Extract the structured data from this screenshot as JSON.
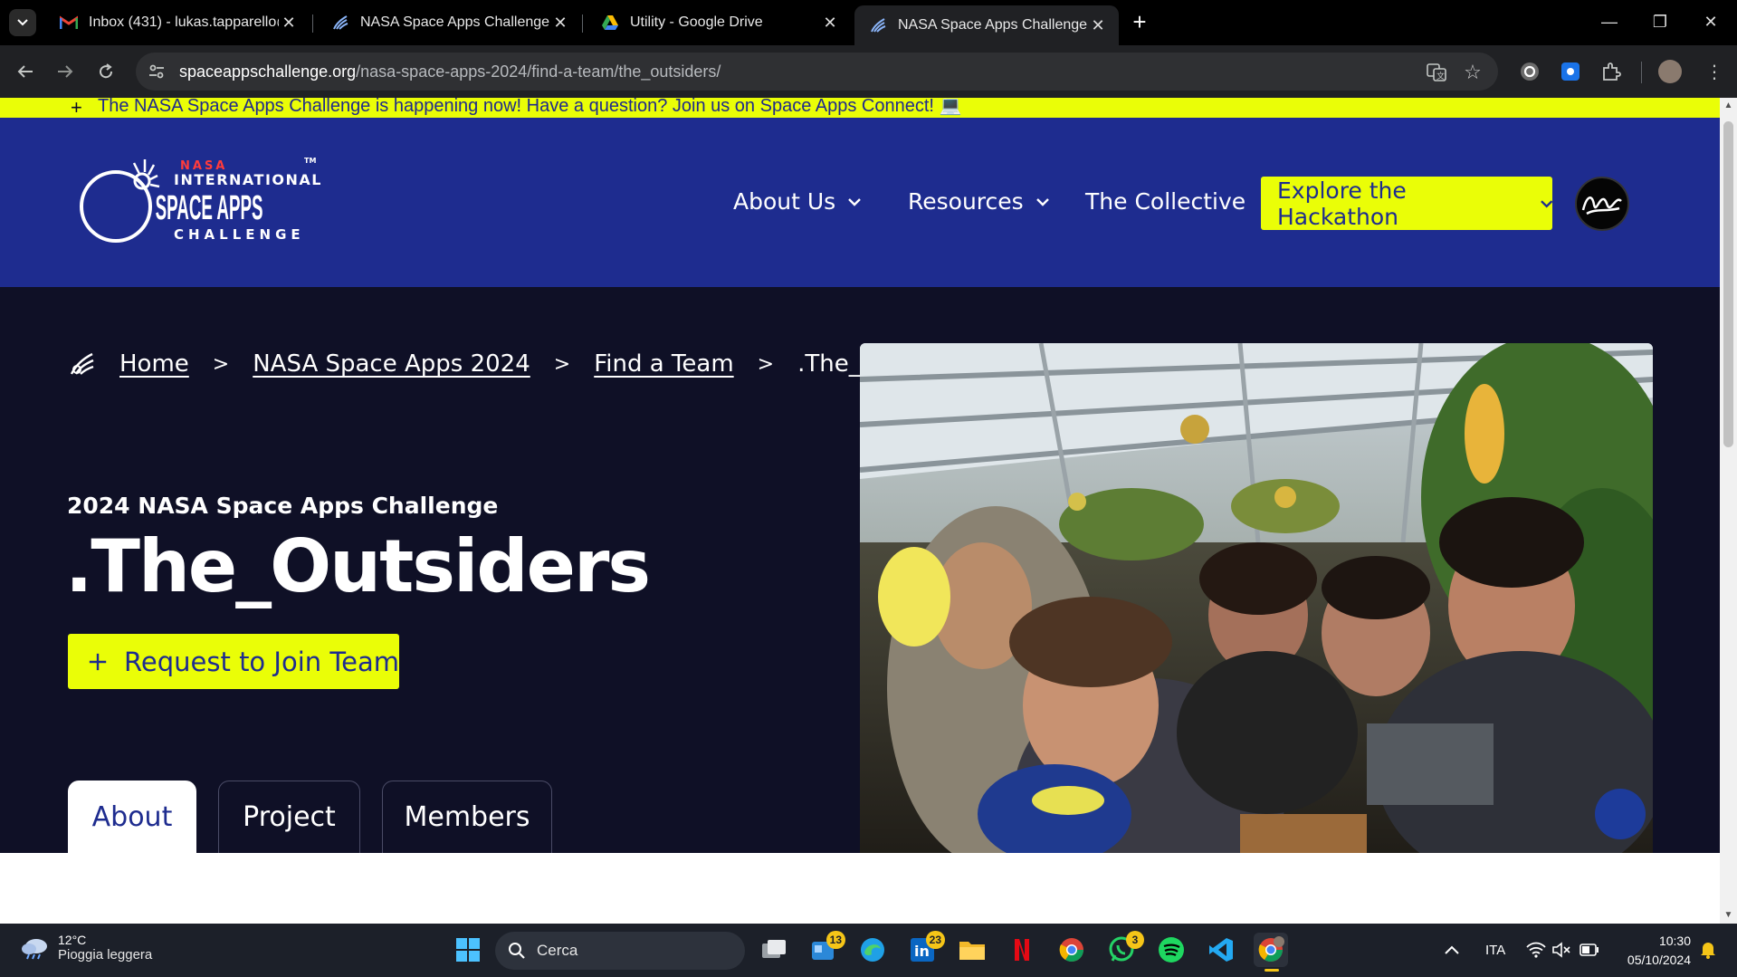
{
  "browser": {
    "tabs": [
      {
        "title": "Inbox (431) - lukas.tapparello@",
        "icon": "gmail-icon",
        "active": false
      },
      {
        "title": "NASA Space Apps Challenge",
        "icon": "space-apps-icon",
        "active": false
      },
      {
        "title": "Utility - Google Drive",
        "icon": "google-drive-icon",
        "active": false
      },
      {
        "title": "NASA Space Apps Challenge",
        "icon": "space-apps-icon",
        "active": true
      }
    ],
    "url_host": "spaceappschallenge.org",
    "url_path": "/nasa-space-apps-2024/find-a-team/the_outsiders/"
  },
  "page": {
    "banner_text": "The NASA Space Apps Challenge is happening now! Have a question? Join us on Space Apps Connect! 💻",
    "logo": {
      "line1": "NASA",
      "line2": "INTERNATIONAL",
      "line3": "SPACE APPS",
      "line4": "CHALLENGE",
      "tm": "TM"
    },
    "nav": {
      "about": "About Us",
      "resources": "Resources",
      "collective": "The Collective",
      "cta": "Explore the Hackathon"
    },
    "breadcrumb": {
      "home": "Home",
      "event": "NASA Space Apps 2024",
      "find_team": "Find a Team",
      "current": ".The_Outsiders"
    },
    "hero": {
      "subtitle": "2024 NASA Space Apps Challenge",
      "title": ".The_Outsiders",
      "join_button": "Request to Join Team"
    },
    "tabs": [
      "About",
      "Project",
      "Members"
    ],
    "colors": {
      "brand_blue": "#1e2c8f",
      "accent_yellow": "#eafe07",
      "hero_bg": "#0f1026"
    }
  },
  "taskbar": {
    "weather_temp": "12°C",
    "weather_condition": "Pioggia leggera",
    "search_label": "Cerca",
    "badges": {
      "widgets": "13",
      "linkedin": "23",
      "whatsapp": "3"
    },
    "language": "ITA",
    "time": "10:30",
    "date": "05/10/2024"
  }
}
